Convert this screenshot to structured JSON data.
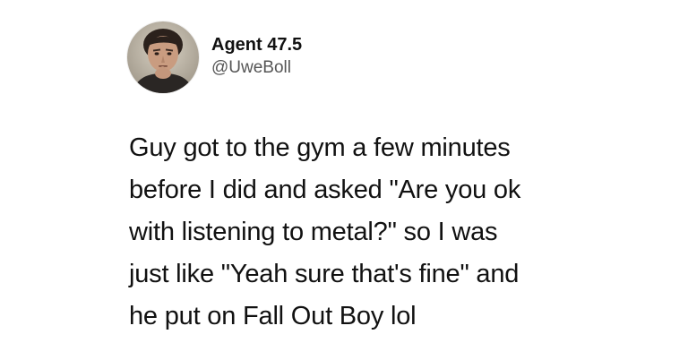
{
  "tweet": {
    "author": {
      "display_name": "Agent 47.5",
      "handle": "@UweBoll"
    },
    "text_lines": [
      "Guy got to the gym a few minutes",
      "before I did and asked \"Are you ok",
      "with listening to metal?\" so I was",
      "just like \"Yeah sure that's fine\" and",
      "he put on Fall Out Boy lol"
    ]
  }
}
